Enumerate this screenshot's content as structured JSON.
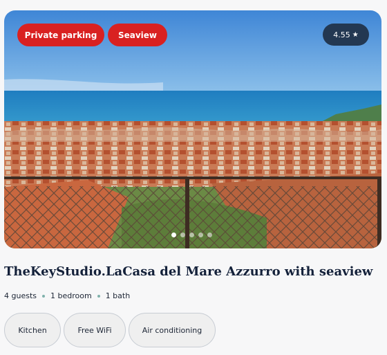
{
  "listing": {
    "tags": [
      "Private parking",
      "Seaview"
    ],
    "rating": "4.55",
    "title": "TheKeyStudio.LaCasa del Mare Azzurro with seaview",
    "facts": [
      "4 guests",
      "1 bedroom",
      "1 bath"
    ],
    "amenities": [
      "Kitchen",
      "Free WiFi",
      "Air conditioning"
    ]
  },
  "gallery": {
    "total_images": 5,
    "active_index": 0
  },
  "icons": {
    "rating": "star-icon"
  },
  "colors": {
    "tag_background": "#d92121",
    "rating_background": "#233852",
    "title": "#14213a"
  }
}
